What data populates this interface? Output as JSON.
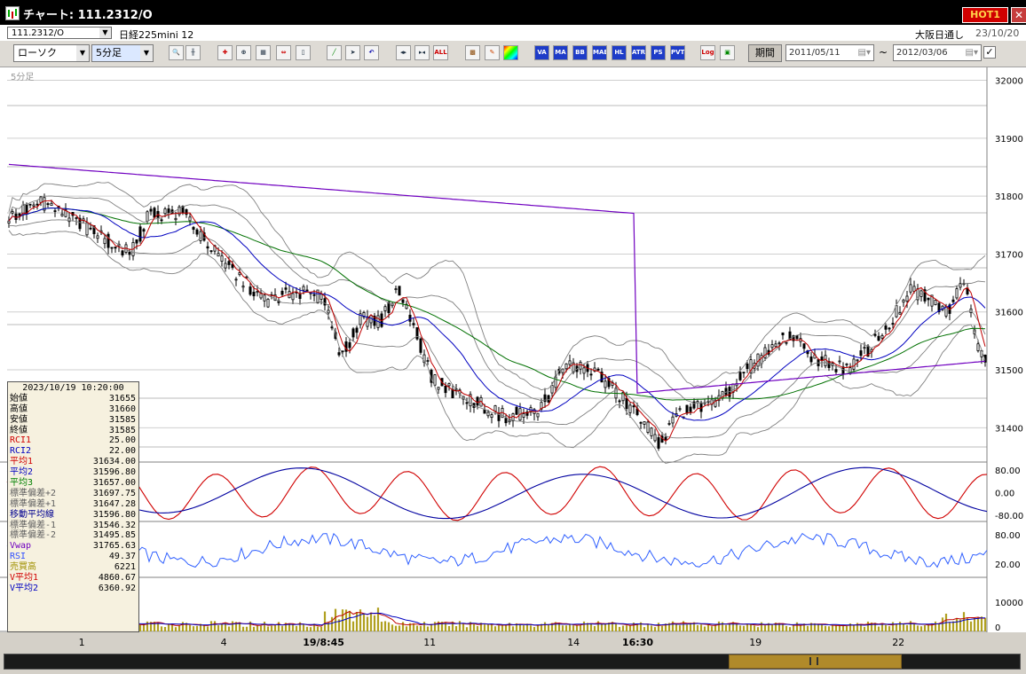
{
  "window": {
    "title": "チャート: 111.2312/O",
    "hot_badge": "HOT1",
    "close_icon": "close-icon"
  },
  "header": {
    "symbol": "111.2312/O",
    "instrument": "日経225mini 12",
    "market": "大阪日通し",
    "date": "23/10/20"
  },
  "toolbar": {
    "chart_type": "ローソク",
    "interval": "5分足",
    "icons": [
      "zoom-icon",
      "cursor-icon",
      "draw-icon",
      "magnify-icon",
      "trend-icon",
      "candle-icon",
      "clear-icon",
      "line-icon",
      "pointer-icon",
      "undo-icon",
      "expand-icon",
      "shrink-icon",
      "all-icon",
      "settings-icon",
      "brush-icon",
      "color-icon",
      "va-icon",
      "ma-icon",
      "bb-icon",
      "mae-icon",
      "hl-icon",
      "atr-icon",
      "ps-icon",
      "pvt-icon",
      "log-icon",
      "export-icon"
    ],
    "icon_labels": {
      "all": "ALL",
      "va": "VA",
      "ma": "MA",
      "bb": "BB",
      "mae": "MAE",
      "hl": "HL",
      "atr": "ATR",
      "ps": "PS",
      "pvt": "PVT",
      "log": "Log"
    },
    "period_label": "期間",
    "from_date": "2011/05/11",
    "tilde": "~",
    "to_date": "2012/03/06",
    "check": "✓"
  },
  "chart_data": {
    "type": "candlestick",
    "timeframe_label": "5分足",
    "price_axis": {
      "ticks": [
        "32000",
        "31900",
        "31800",
        "31700",
        "31600",
        "31500",
        "31400"
      ],
      "range": [
        31350,
        32010
      ]
    },
    "rci_axis": {
      "ticks": [
        "80.00",
        "0.00",
        "-80.00"
      ]
    },
    "rsi_axis": {
      "ticks": [
        "80.00",
        "20.00"
      ]
    },
    "volume_axis": {
      "ticks": [
        "10000",
        "0"
      ]
    },
    "x_labels": [
      {
        "text": "1",
        "bold": false
      },
      {
        "text": "4",
        "bold": false
      },
      {
        "text": "19/8:45",
        "bold": true
      },
      {
        "text": "11",
        "bold": false
      },
      {
        "text": "14",
        "bold": false
      },
      {
        "text": "16:30",
        "bold": true
      },
      {
        "text": "19",
        "bold": false
      },
      {
        "text": "22",
        "bold": false
      }
    ],
    "colors": {
      "up": "#ffffff",
      "down": "#000000",
      "ma_short": "#c00000",
      "ma_mid": "#0000c0",
      "ma_long": "#007000",
      "vwap": "#7000c0",
      "bands": "#808080",
      "rci1": "#d00000",
      "rci2": "#0000a0",
      "rsi": "#3060ff",
      "volume": "#b0a020"
    }
  },
  "info_panel": {
    "datetime": "2023/10/19  10:20:00",
    "rows": [
      {
        "label": "始値",
        "value": "31655",
        "color": "#000000"
      },
      {
        "label": "高値",
        "value": "31660",
        "color": "#000000"
      },
      {
        "label": "安値",
        "value": "31585",
        "color": "#000000"
      },
      {
        "label": "終値",
        "value": "31585",
        "color": "#000000"
      },
      {
        "label": "RCI1",
        "value": "25.00",
        "color": "#d00000"
      },
      {
        "label": "RCI2",
        "value": "22.00",
        "color": "#0000c0"
      },
      {
        "label": "平均1",
        "value": "31634.00",
        "color": "#d00000"
      },
      {
        "label": "平均2",
        "value": "31596.80",
        "color": "#0000c0"
      },
      {
        "label": "平均3",
        "value": "31657.00",
        "color": "#008000"
      },
      {
        "label": "標準偏差+2",
        "value": "31697.75",
        "color": "#606060"
      },
      {
        "label": "標準偏差+1",
        "value": "31647.28",
        "color": "#606060"
      },
      {
        "label": "移動平均線",
        "value": "31596.80",
        "color": "#000090"
      },
      {
        "label": "標準偏差-1",
        "value": "31546.32",
        "color": "#606060"
      },
      {
        "label": "標準偏差-2",
        "value": "31495.85",
        "color": "#606060"
      },
      {
        "label": "Vwap",
        "value": "31765.63",
        "color": "#7000c0"
      },
      {
        "label": "RSI",
        "value": "49.37",
        "color": "#3050ff"
      },
      {
        "label": "売買高",
        "value": "6221",
        "color": "#a09000"
      },
      {
        "label": "V平均1",
        "value": "4860.67",
        "color": "#d00000"
      },
      {
        "label": "V平均2",
        "value": "6360.92",
        "color": "#0000c0"
      }
    ]
  }
}
